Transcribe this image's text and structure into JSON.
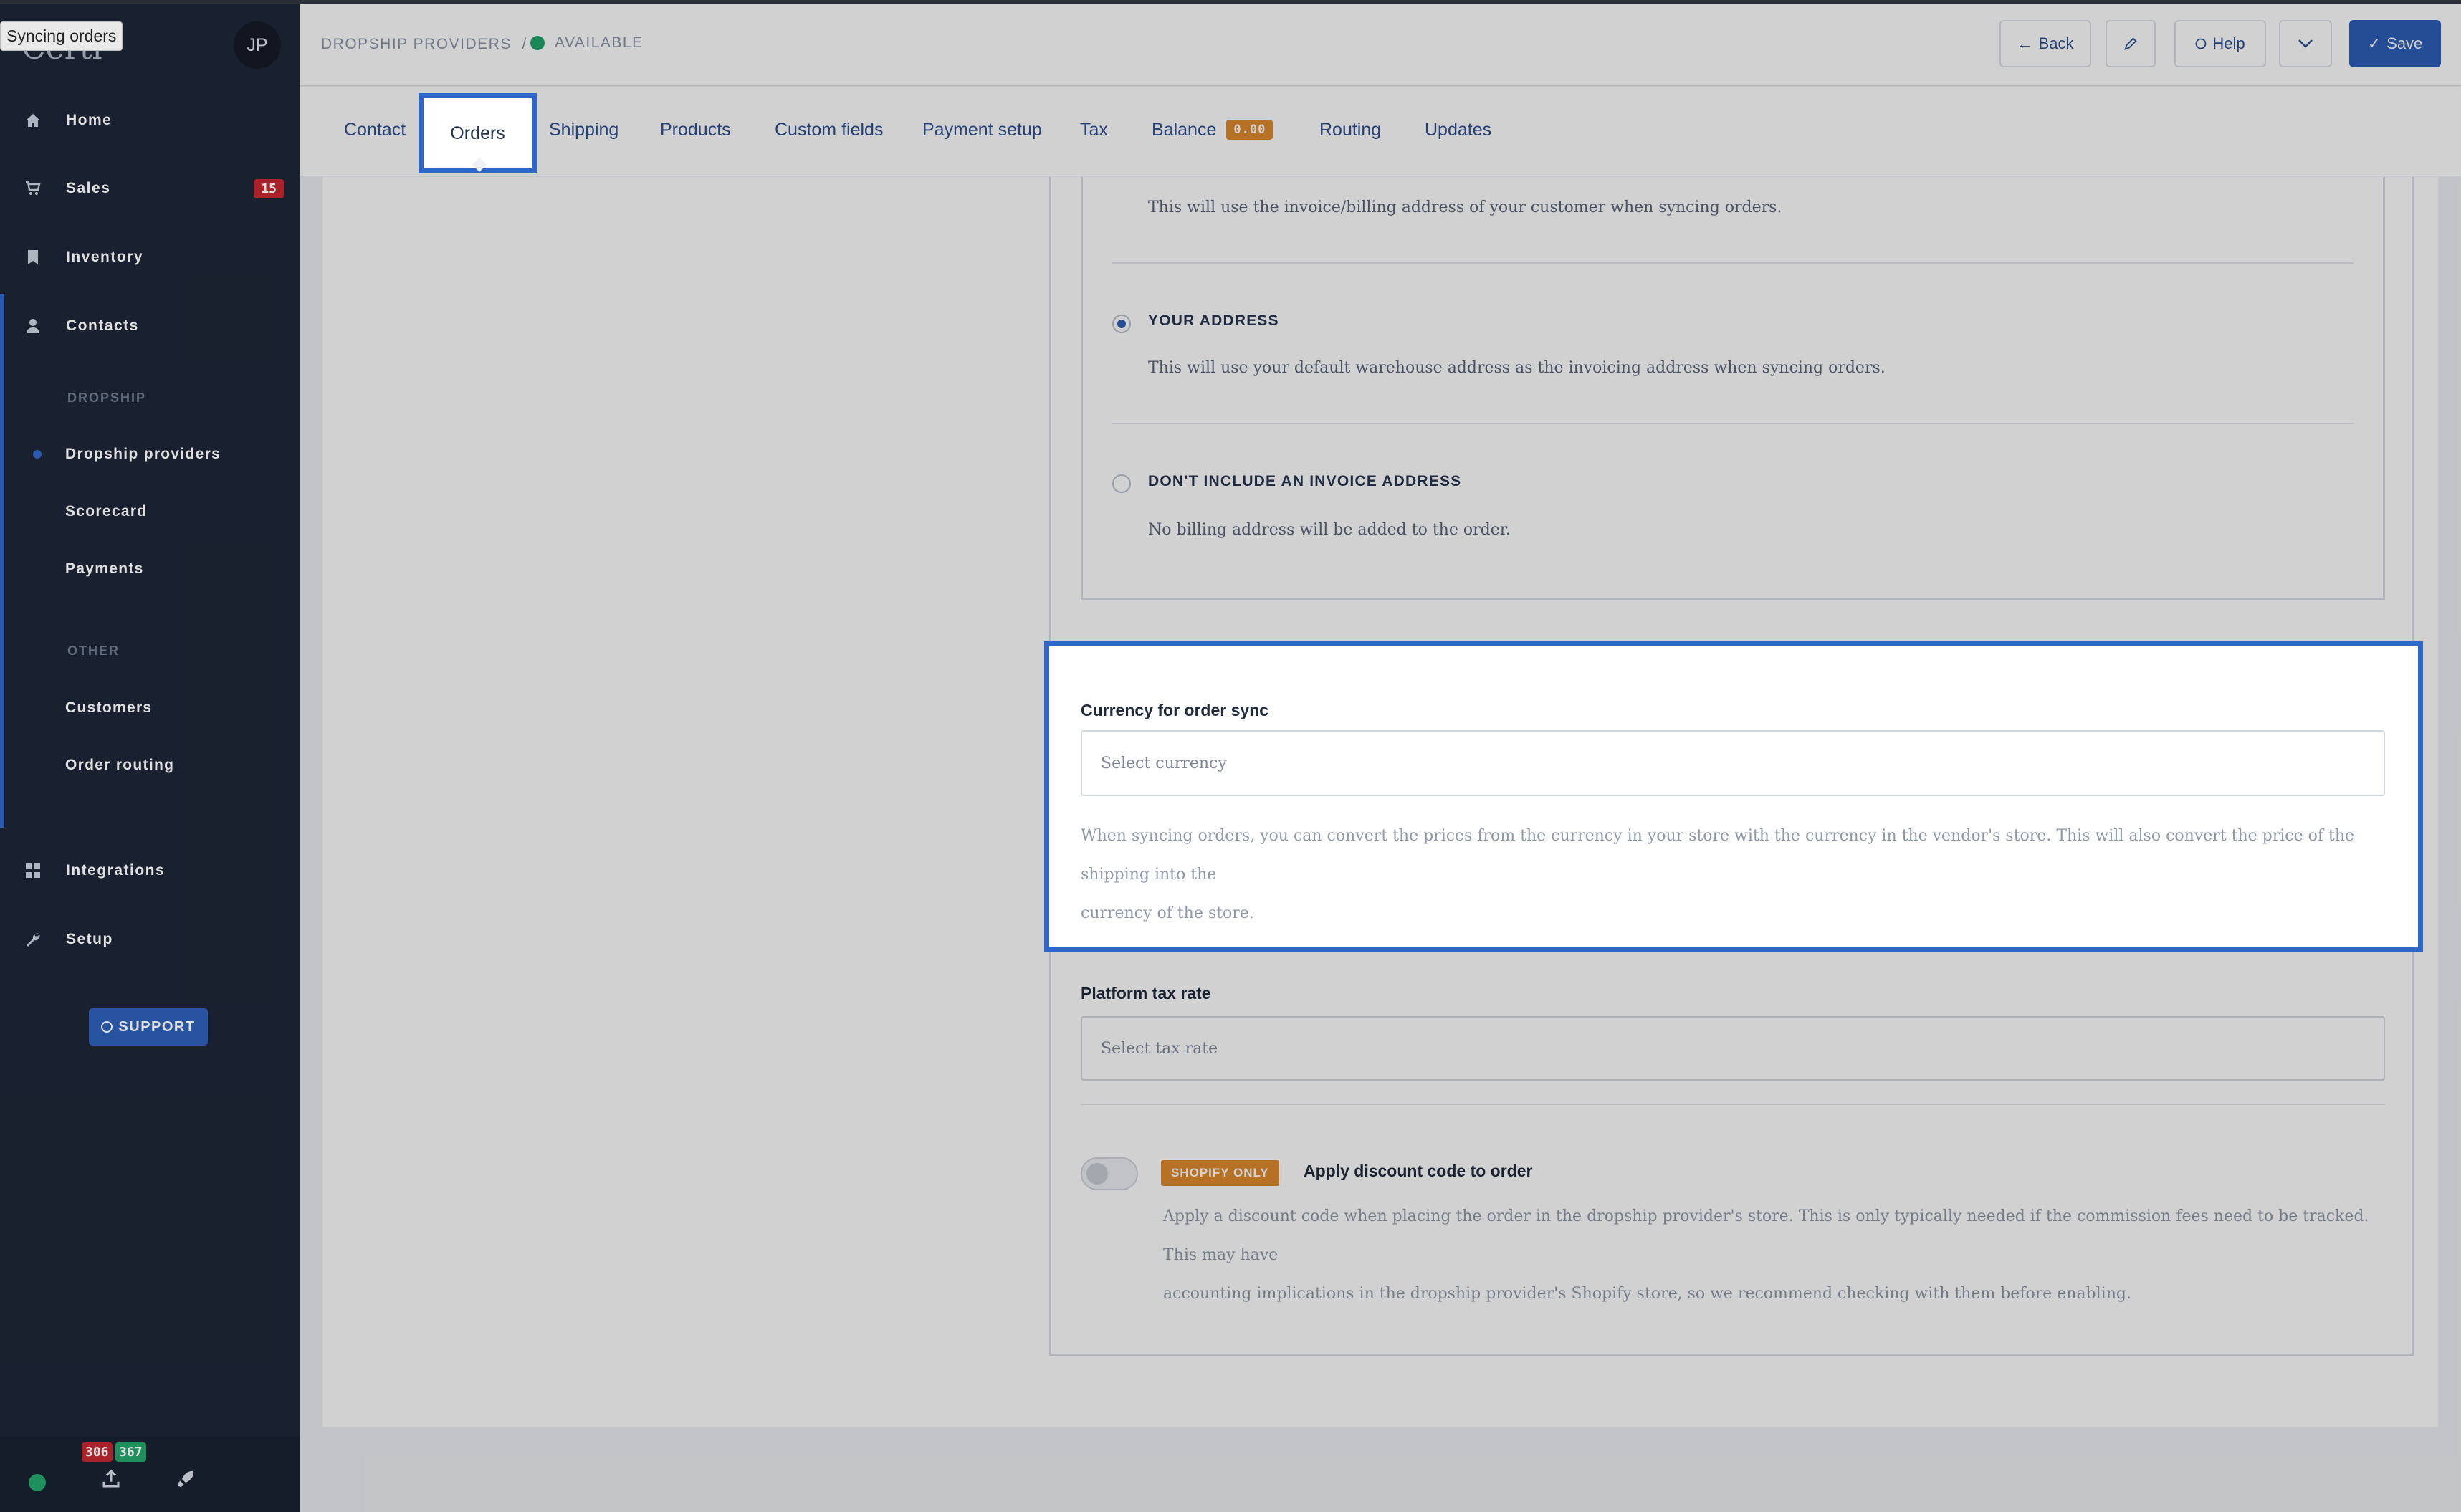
{
  "tooltip": "Syncing orders",
  "logo": "Certi",
  "user_initials": "JP",
  "sidebar": {
    "nav": [
      {
        "label": "Home",
        "icon": "home-icon"
      },
      {
        "label": "Sales",
        "icon": "cart-icon",
        "badge": "15"
      },
      {
        "label": "Inventory",
        "icon": "bookmark-icon"
      },
      {
        "label": "Contacts",
        "icon": "person-icon"
      }
    ],
    "dropship_label": "DROPSHIP",
    "dropship_items": [
      "Dropship providers",
      "Scorecard",
      "Payments"
    ],
    "other_label": "OTHER",
    "other_items": [
      "Customers",
      "Order routing"
    ],
    "bottom_nav": [
      {
        "label": "Integrations",
        "icon": "grid-icon"
      },
      {
        "label": "Setup",
        "icon": "wrench-icon"
      }
    ],
    "support_label": "SUPPORT",
    "counters": {
      "red": "306",
      "green": "367"
    }
  },
  "header": {
    "breadcrumb": "DROPSHIP PROVIDERS",
    "status": "AVAILABLE",
    "back_label": "Back",
    "help_label": "Help",
    "save_label": "Save"
  },
  "tabs": [
    {
      "label": "Contact"
    },
    {
      "label": "Orders",
      "active": true
    },
    {
      "label": "Shipping"
    },
    {
      "label": "Products"
    },
    {
      "label": "Custom fields"
    },
    {
      "label": "Payment setup"
    },
    {
      "label": "Tax"
    },
    {
      "label": "Balance",
      "badge": "0.00"
    },
    {
      "label": "Routing"
    },
    {
      "label": "Updates"
    }
  ],
  "address": {
    "customer_desc": "This will use the invoice/billing address of your customer when syncing orders.",
    "your_address_label": "YOUR ADDRESS",
    "your_address_desc": "This will use your default warehouse address as the invoicing address when syncing orders.",
    "none_label": "DON'T INCLUDE AN INVOICE ADDRESS",
    "none_desc": "No billing address will be added to the order."
  },
  "currency": {
    "label": "Currency for order sync",
    "placeholder": "Select currency",
    "help_line1": "When syncing orders, you can convert the prices from the currency in your store with the currency in the vendor's store. This will also convert the price of the shipping into the",
    "help_line2": "currency of the store."
  },
  "tax": {
    "label": "Platform tax rate",
    "placeholder": "Select tax rate"
  },
  "discount": {
    "badge": "SHOPIFY ONLY",
    "title": "Apply discount code to order",
    "help_line1": "Apply a discount code when placing the order in the dropship provider's store. This is only typically needed if the commission fees need to be tracked. This may have",
    "help_line2": "accounting implications in the dropship provider's Shopify store, so we recommend checking with them before enabling.",
    "enabled": false
  },
  "colors": {
    "accent": "#2f66c9",
    "sidebar_bg": "#1d2536",
    "badge_orange": "#e08a2c",
    "badge_red": "#c0282f",
    "status_green": "#23a36a"
  }
}
